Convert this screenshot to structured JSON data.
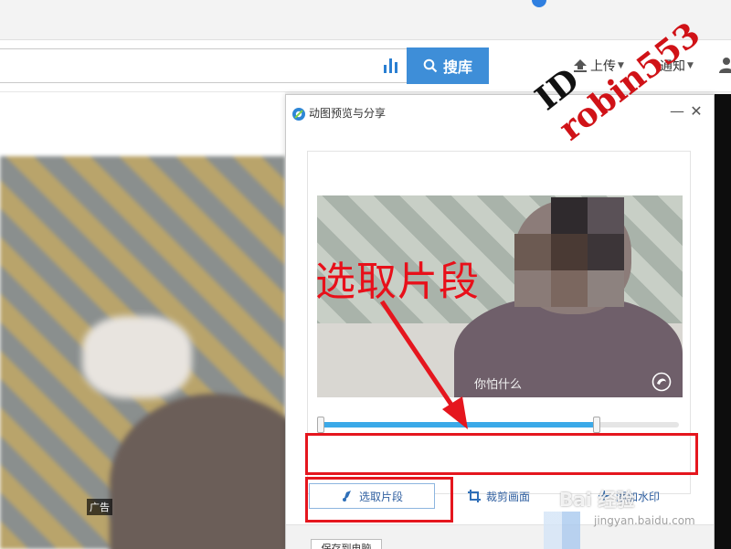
{
  "header": {
    "search_placeholder": "",
    "search_button": "搜库",
    "upload_label": "上传",
    "notify_label": "通知"
  },
  "left_video": {
    "ad_label": "广告"
  },
  "dialog": {
    "title": "动图预览与分享",
    "min_glyph": "—",
    "close_glyph": "✕",
    "caption": "你怕什么",
    "timeline": {
      "start": 0.0,
      "end": 0.77
    },
    "tools": [
      {
        "label": "选取片段",
        "icon": "scissors-icon",
        "active": true
      },
      {
        "label": "裁剪画面",
        "icon": "crop-icon",
        "active": false
      },
      {
        "label": "添加水印",
        "icon": "plus-icon",
        "active": false
      }
    ],
    "save_button": "保存到电脑"
  },
  "annotations": {
    "big_label": "选取片段",
    "id_prefix": "ID",
    "id_name": "robin553",
    "site_mark": "Bai 经验",
    "site_url": "jingyan.baidu.com"
  },
  "colors": {
    "accent": "#3e8ed8",
    "timeline": "#3ba9e8",
    "annotation_red": "#e5161e"
  }
}
